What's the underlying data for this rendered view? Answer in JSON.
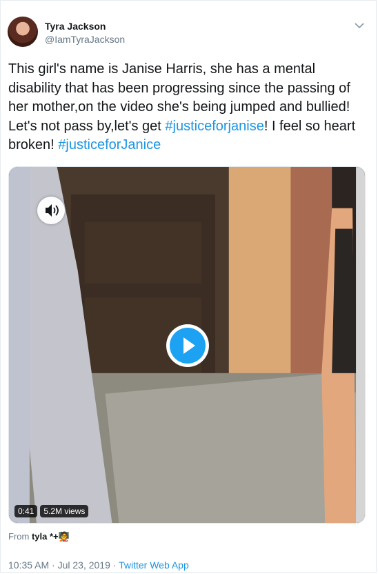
{
  "tweet": {
    "author_name": "Tyra Jackson",
    "author_handle": "@IamTyraJackson",
    "text_1": "This girl's name is Janise Harris, she has a mental disability that has been progressing since the passing of her mother,on the video she's being jumped and bullied! Let's not pass by,let's get ",
    "hashtag_1": "#justiceforjanise",
    "text_2": "! I feel so heart broken! ",
    "hashtag_2": "#justiceforJanice"
  },
  "media": {
    "duration": "0:41",
    "views": "5.2M views",
    "sound_icon": "speaker-icon",
    "play_icon": "play-icon"
  },
  "source": {
    "prefix": "From",
    "account": "tyla *+🧑‍🏫"
  },
  "meta": {
    "timestamp": "10:35 AM · Jul 23, 2019",
    "separator": " · ",
    "app": "Twitter Web App"
  },
  "colors": {
    "link": "#1b95e0",
    "play": "#1da1f2",
    "secondary_text": "#657786"
  }
}
